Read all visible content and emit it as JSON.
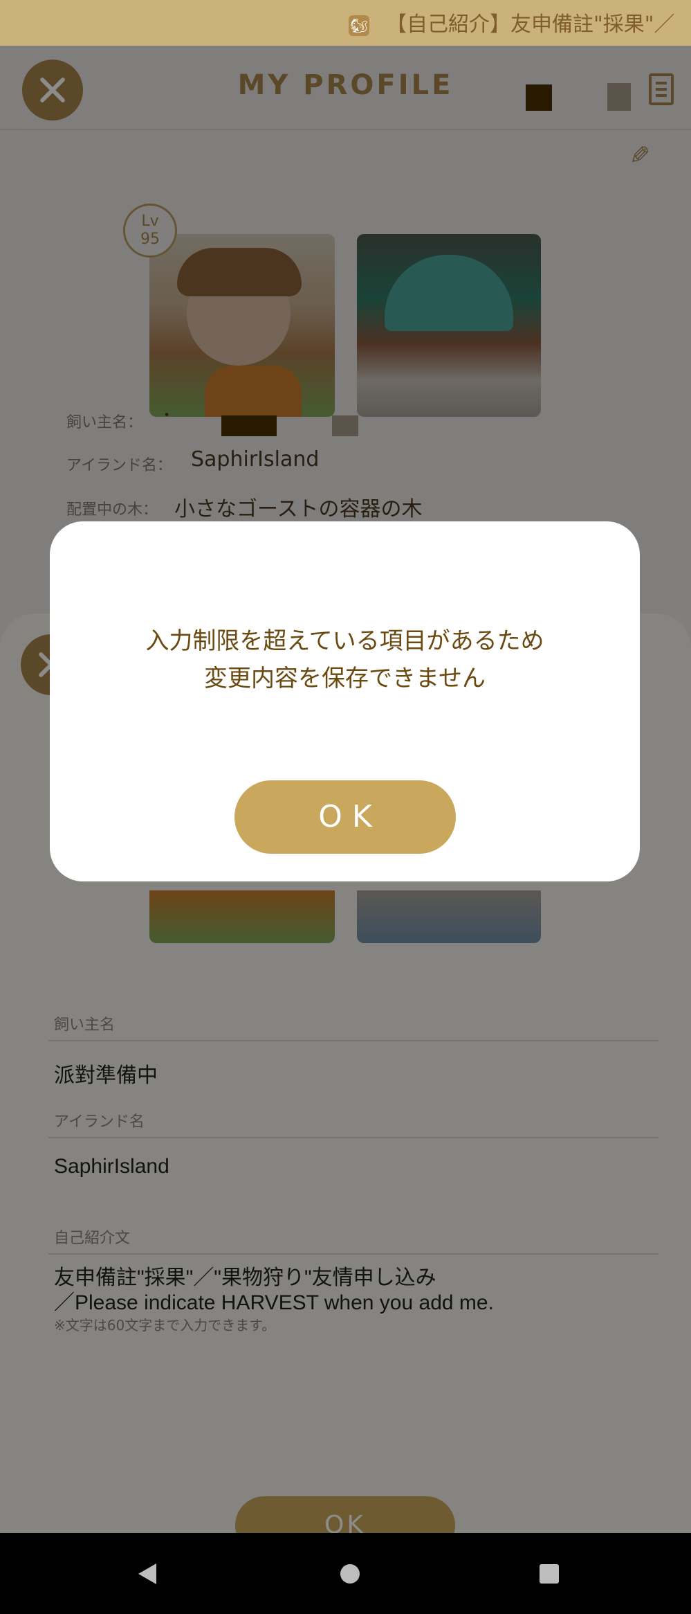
{
  "ticker": {
    "icon": "squirrel-avatar-icon",
    "text": "【自己紹介】友申備註\"採果\"／"
  },
  "header": {
    "title": "MY PROFILE"
  },
  "profile": {
    "level_label": "Lv",
    "level_value": "95",
    "owner_label": "飼い主名：",
    "owner_value": "・",
    "island_label": "アイランド名：",
    "island_value": "SaphirIsland",
    "tree_label": "配置中の木：",
    "tree_value": "小さなゴーストの容器の木"
  },
  "form": {
    "owner_label": "飼い主名",
    "owner_value": "派對準備中",
    "island_label": "アイランド名",
    "island_value": "SaphirIsland",
    "intro_label": "自己紹介文",
    "intro_line1": "友申備註\"採果\"／\"果物狩り\"友情申し込み",
    "intro_line2": "／Please indicate HARVEST when you add me.",
    "intro_note": "※文字は60文字まで入力できます。",
    "ok_label": "OK"
  },
  "dialog": {
    "message_line1": "入力制限を超えている項目があるため",
    "message_line2": "変更内容を保存できません",
    "ok_label": "OK"
  },
  "colors": {
    "accent_gold": "#c9a75d",
    "dialog_text": "#6b4a12",
    "overlay": "rgba(0,0,0,0.45)"
  }
}
